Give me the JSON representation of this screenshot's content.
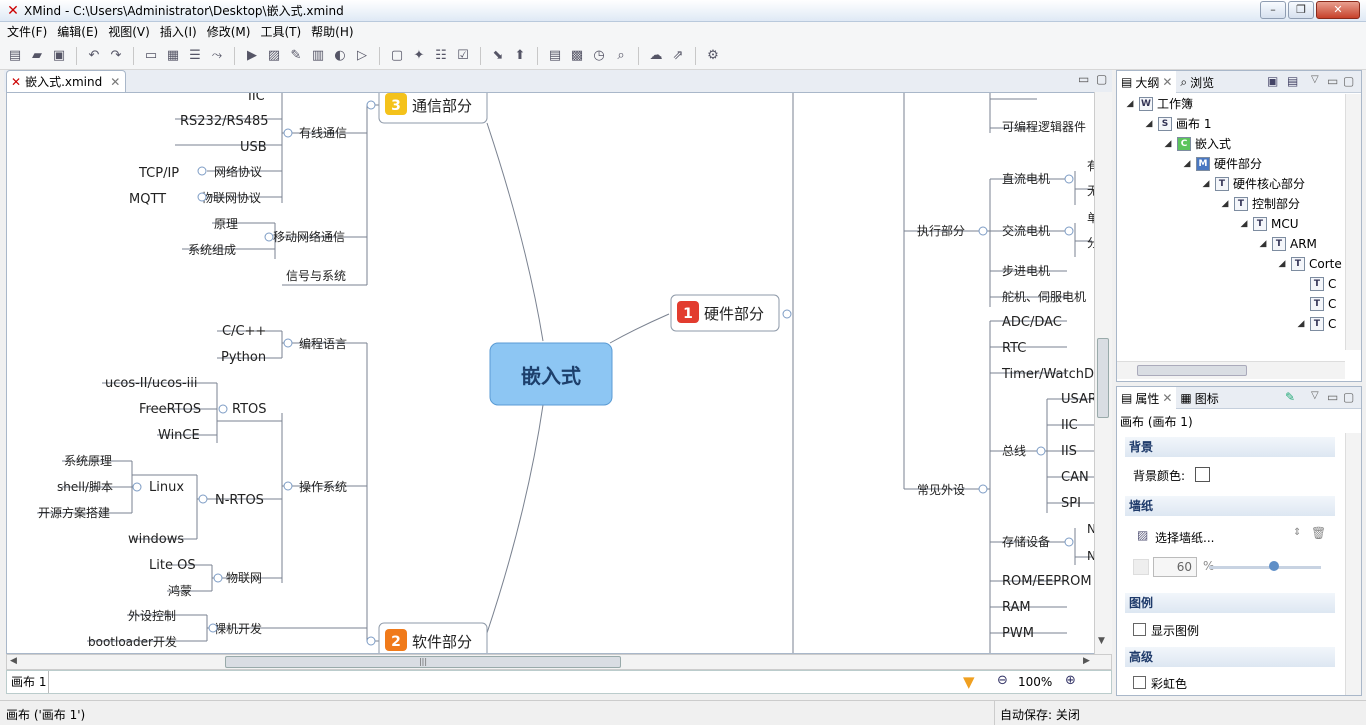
{
  "window": {
    "title": "XMind - C:\\Users\\Administrator\\Desktop\\嵌入式.xmind",
    "app_icon": "xmind-icon"
  },
  "menu": [
    "文件(F)",
    "编辑(E)",
    "视图(V)",
    "插入(I)",
    "修改(M)",
    "工具(T)",
    "帮助(H)"
  ],
  "editor": {
    "tab_label": "嵌入式.xmind",
    "sheet_tab": "画布 1",
    "zoom": "100%"
  },
  "mindmap": {
    "central": "嵌入式",
    "main_topics": [
      {
        "num": "1",
        "label": "硬件部分",
        "color": "#e23c2f"
      },
      {
        "num": "2",
        "label": "软件部分",
        "color": "#f07a1a"
      },
      {
        "num": "3",
        "label": "通信部分",
        "color": "#f4c21b"
      }
    ],
    "left_nodes": {
      "iic": "IIC",
      "rs": "RS232/RS485",
      "usb": "USB",
      "tcpip": "TCP/IP",
      "mqtt": "MQTT",
      "wired": "有线通信",
      "netproto": "网络协议",
      "iotproto": "物联网协议",
      "yuanli": "原理",
      "xitong": "系统组成",
      "mobile": "移动网络通信",
      "signal": "信号与系统",
      "cpp": "C/C++",
      "python": "Python",
      "lang": "编程语言",
      "ucos": "ucos-II/ucos-iii",
      "freertos": "FreeRTOS",
      "wince": "WinCE",
      "rtos": "RTOS",
      "sysyuanli": "系统原理",
      "shell": "shell/脚本",
      "opensource": "开源方案搭建",
      "linux": "Linux",
      "windows": "windows",
      "nrtos": "N-RTOS",
      "os": "操作系统",
      "liteos": "Lite OS",
      "hongmeng": "鸿蒙",
      "iot": "物联网",
      "waishe": "外设控制",
      "boot": "bootloader开发",
      "baremetal": "裸机开发"
    },
    "right_nodes": {
      "fpga": "可编程逻辑器件",
      "exec": "执行部分",
      "dc": "直流电机",
      "ac": "交流电机",
      "step": "步进电机",
      "servo": "舵机、伺服电机",
      "dc_c1": "有",
      "dc_c2": "无",
      "ac_c1": "单",
      "ac_c2": "分",
      "adc": "ADC/DAC",
      "rtc": "RTC",
      "timer": "Timer/WatchDog",
      "bus": "总线",
      "usart": "USART",
      "iic": "IIC",
      "iis": "IIS",
      "can": "CAN",
      "spi": "SPI",
      "common": "常见外设",
      "storage": "存储设备",
      "st_c1": "N",
      "st_c2": "N",
      "rom": "ROM/EEPROM",
      "ram": "RAM",
      "pwm": "PWM"
    }
  },
  "outline": {
    "tabs": [
      "大纲",
      "浏览"
    ],
    "items": [
      {
        "label": "工作簿",
        "icon": "W",
        "indent": 0
      },
      {
        "label": "画布 1",
        "icon": "S",
        "indent": 1
      },
      {
        "label": "嵌入式",
        "icon": "C",
        "indent": 2
      },
      {
        "label": "硬件部分",
        "icon": "M",
        "indent": 3
      },
      {
        "label": "硬件核心部分",
        "icon": "T",
        "indent": 4
      },
      {
        "label": "控制部分",
        "icon": "T",
        "indent": 5
      },
      {
        "label": "MCU",
        "icon": "T",
        "indent": 6
      },
      {
        "label": "ARM",
        "icon": "T",
        "indent": 7
      },
      {
        "label": "Corte",
        "icon": "T",
        "indent": 8
      },
      {
        "label": "C",
        "icon": "T",
        "indent": 9
      },
      {
        "label": "C",
        "icon": "T",
        "indent": 9
      },
      {
        "label": "C",
        "icon": "T",
        "indent": 9
      }
    ]
  },
  "properties": {
    "tabs": [
      "属性",
      "图标"
    ],
    "subject": "画布 (画布 1)",
    "background_section": "背景",
    "bg_color_label": "背景颜色:",
    "wallpaper_section": "墙纸",
    "wallpaper_select": "选择墙纸...",
    "opacity": "60",
    "percent": "%",
    "legend_section": "图例",
    "show_legend": "显示图例",
    "advanced_section": "高级",
    "multi_color": "彩虹色"
  },
  "status": {
    "left": "画布 ('画布 1')",
    "autosave": "自动保存: 关闭"
  }
}
